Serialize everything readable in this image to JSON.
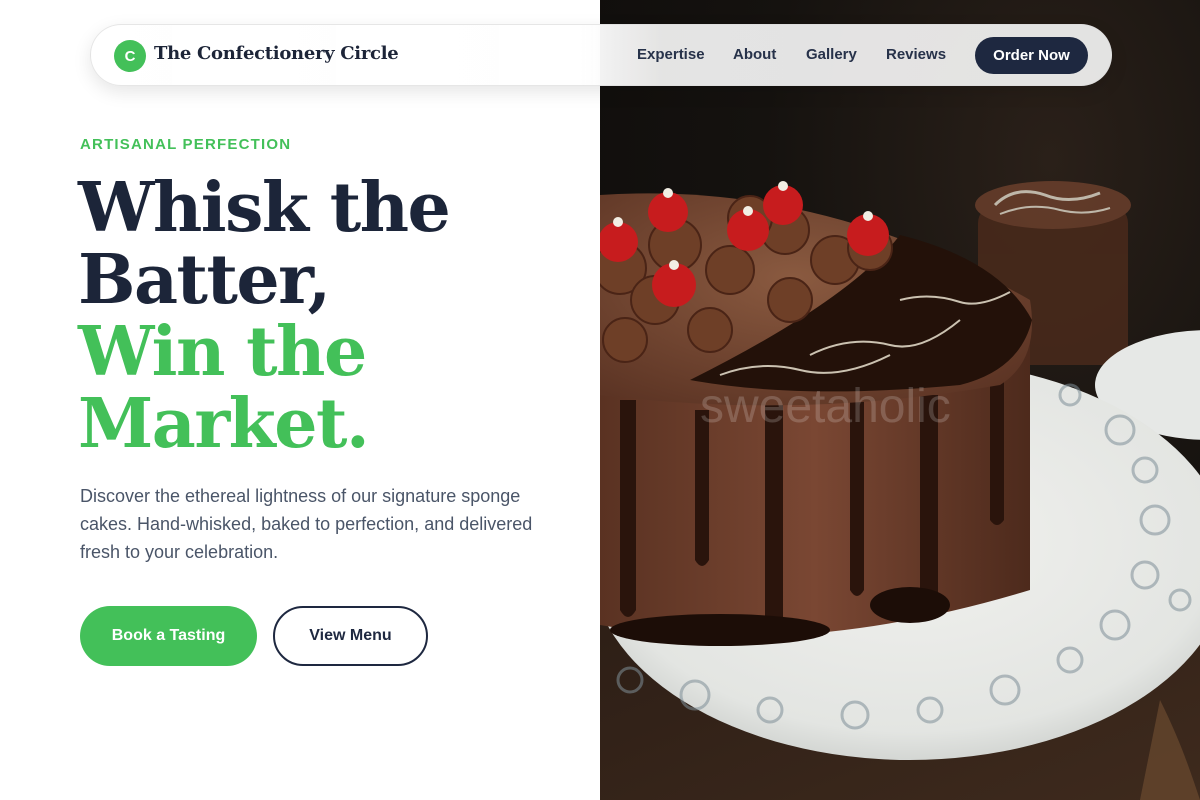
{
  "nav": {
    "logo_letter": "C",
    "brand": "The Confectionery Circle",
    "links": [
      "Expertise",
      "About",
      "Gallery",
      "Reviews"
    ],
    "cta": "Order Now"
  },
  "hero": {
    "eyebrow": "ARTISANAL PERFECTION",
    "headline_line1": "Whisk the",
    "headline_line2": "Batter,",
    "headline_line3": "Win the",
    "headline_line4": "Market.",
    "lede": "Discover the ethereal lightness of our signature sponge cakes. Hand-whisked, baked to perfection, and delivered fresh to your celebration.",
    "primary_button": "Book a Tasting",
    "secondary_button": "View Menu"
  },
  "image": {
    "subject": "chocolate-cake-with-cherries-photo",
    "watermark": "sweetaholic"
  },
  "colors": {
    "accent": "#43c059",
    "navy": "#1e2840",
    "heading": "#1c2539",
    "body_text": "#4a5568"
  }
}
